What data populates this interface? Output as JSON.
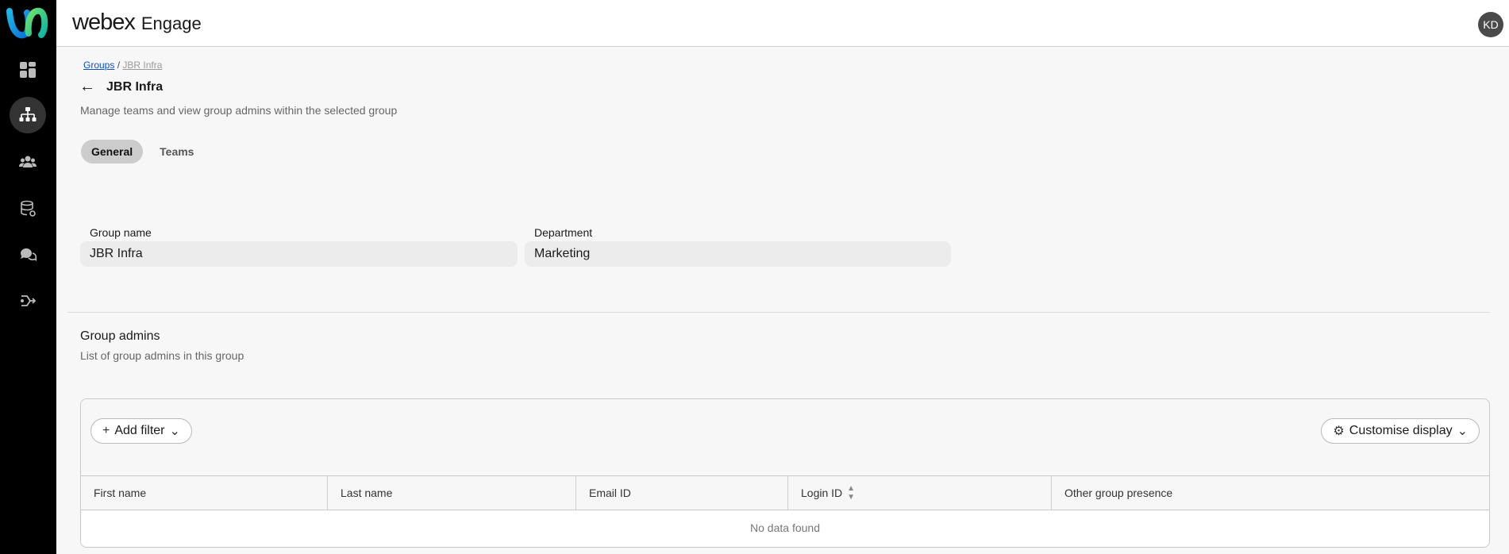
{
  "header": {
    "brand_word": "webex",
    "brand_product": "Engage",
    "avatar_initials": "KD"
  },
  "nav": {
    "items": [
      {
        "icon": "dashboard-icon"
      },
      {
        "icon": "org-hierarchy-icon",
        "active": true
      },
      {
        "icon": "users-group-icon"
      },
      {
        "icon": "database-icon"
      },
      {
        "icon": "chat-bubbles-icon"
      },
      {
        "icon": "integrations-icon"
      }
    ]
  },
  "breadcrumb": {
    "root": "Groups",
    "separator": "/",
    "current": "JBR Infra"
  },
  "page": {
    "title": "JBR Infra",
    "subtitle": "Manage teams and view group admins within the selected group"
  },
  "tabs": [
    {
      "label": "General",
      "active": true
    },
    {
      "label": "Teams",
      "active": false
    }
  ],
  "fields": {
    "group_name": {
      "label": "Group name",
      "value": "JBR Infra"
    },
    "department": {
      "label": "Department",
      "value": "Marketing"
    }
  },
  "admins": {
    "title": "Group admins",
    "subtitle": "List of group admins in this group",
    "add_filter": "Add filter",
    "customise_display": "Customise display",
    "columns": [
      "First name",
      "Last name",
      "Email ID",
      "Login ID",
      "Other group presence"
    ],
    "empty_text": "No data found"
  }
}
